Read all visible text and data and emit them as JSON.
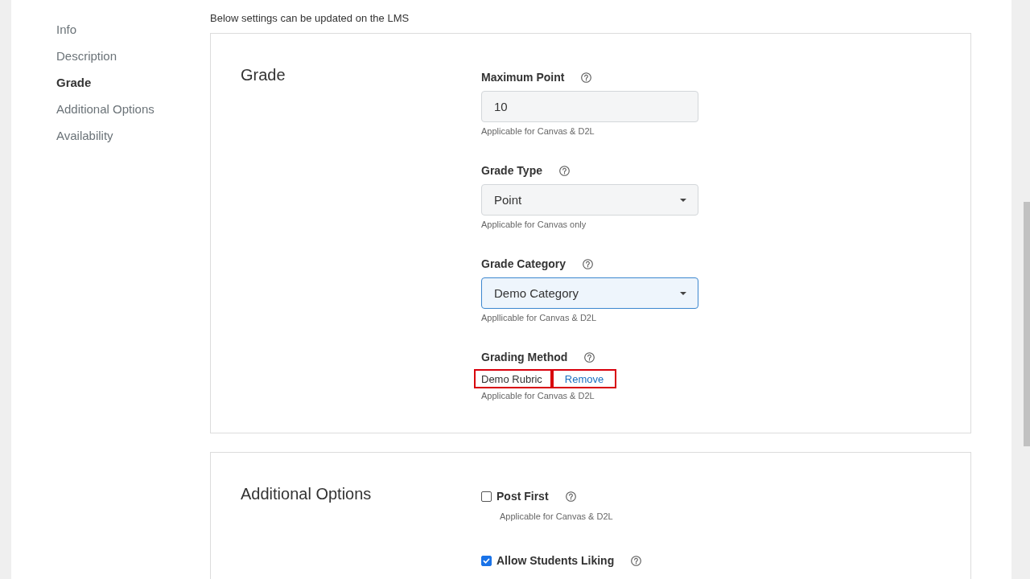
{
  "sidebar": {
    "items": [
      {
        "label": "Info",
        "selected": false
      },
      {
        "label": "Description",
        "selected": false
      },
      {
        "label": "Grade",
        "selected": true
      },
      {
        "label": "Additional Options",
        "selected": false
      },
      {
        "label": "Availability",
        "selected": false
      }
    ]
  },
  "notice": "Below settings can be updated on the LMS",
  "sections": [
    {
      "title": "Grade",
      "fields": [
        {
          "kind": "input",
          "label": "Maximum Point",
          "value": "10",
          "focused": false,
          "hint": "Applicable for Canvas & D2L"
        },
        {
          "kind": "select",
          "label": "Grade Type",
          "value": "Point",
          "focused": false,
          "hint": "Applicable for Canvas only"
        },
        {
          "kind": "select",
          "label": "Grade Category",
          "value": "Demo Category",
          "focused": true,
          "hint": "Appllicable for Canvas & D2L"
        },
        {
          "kind": "attachment",
          "label": "Grading Method",
          "value": "Demo Rubric",
          "action": "Remove",
          "highlighted": true,
          "hint": "Applicable for Canvas & D2L"
        }
      ]
    },
    {
      "title": "Additional Options",
      "fields": [
        {
          "kind": "checkbox",
          "label": "Post First",
          "checked": false,
          "hint": "Applicable for Canvas & D2L"
        },
        {
          "kind": "checkbox",
          "label": "Allow Students Liking",
          "checked": true
        }
      ]
    }
  ]
}
